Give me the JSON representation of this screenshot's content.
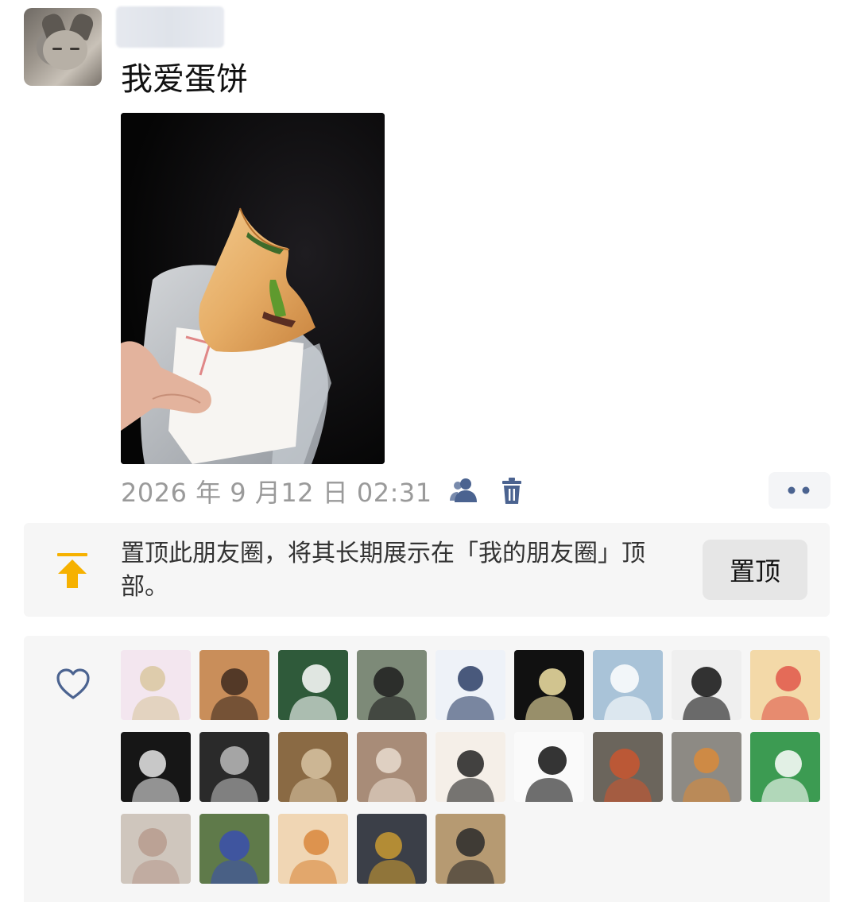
{
  "post": {
    "author_avatar": "cat-avatar",
    "text": "我爱蛋饼",
    "photo": "egg-pancake-photo",
    "timestamp": "2026 年 9 月12 日 02:31"
  },
  "actions": {
    "visibility_icon": "people-icon",
    "delete_icon": "trash-icon",
    "more_icon": "more-dots-icon"
  },
  "pin": {
    "message": "置顶此朋友圈，将其长期展示在「我的朋友圈」顶部。",
    "button_label": "置顶",
    "icon": "pin-to-top-icon",
    "accent_color": "#F6B100"
  },
  "likes": {
    "icon": "heart-outline-icon",
    "avatars": [
      {
        "name": "anime-girl-avatar",
        "bg": "#f3e6ef",
        "fg": "#d9c7a0"
      },
      {
        "name": "girl-with-crown-avatar",
        "bg": "#c98e5a",
        "fg": "#3e2a1e"
      },
      {
        "name": "green-eyes-avatar",
        "bg": "#2f5a3a",
        "fg": "#ffffff"
      },
      {
        "name": "man-outdoors-avatar",
        "bg": "#7d8a78",
        "fg": "#1d1d1d"
      },
      {
        "name": "police-cartoon-avatar",
        "bg": "#eef2f8",
        "fg": "#2b3e66"
      },
      {
        "name": "police-mascot-avatar",
        "bg": "#111111",
        "fg": "#f3e4a6"
      },
      {
        "name": "dog-blue-hat-avatar",
        "bg": "#a9c3d8",
        "fg": "#ffffff"
      },
      {
        "name": "silhouette-avatar",
        "bg": "#efefef",
        "fg": "#111111"
      },
      {
        "name": "redhead-cartoon-avatar",
        "bg": "#f3d9a8",
        "fg": "#e0574a"
      },
      {
        "name": "dark-hair-portrait-avatar",
        "bg": "#161616",
        "fg": "#e8e8e8"
      },
      {
        "name": "bw-couple-avatar",
        "bg": "#2a2a2a",
        "fg": "#bbbbbb"
      },
      {
        "name": "kid-reading-avatar",
        "bg": "#8a6a44",
        "fg": "#d7c3a2"
      },
      {
        "name": "woman-with-toy-avatar",
        "bg": "#a88c78",
        "fg": "#e9dccf"
      },
      {
        "name": "manga-man-avatar",
        "bg": "#f5efe8",
        "fg": "#222222"
      },
      {
        "name": "spiky-hair-sketch-avatar",
        "bg": "#fafafa",
        "fg": "#111111"
      },
      {
        "name": "autumn-street-avatar",
        "bg": "#6b655c",
        "fg": "#c9562f"
      },
      {
        "name": "tiger-cub-avatar",
        "bg": "#8d8a84",
        "fg": "#d98a3a"
      },
      {
        "name": "dog-cartoon-avatar",
        "bg": "#3c9b52",
        "fg": "#ffffff"
      },
      {
        "name": "pig-avatar",
        "bg": "#cfc6bd",
        "fg": "#b79b8e"
      },
      {
        "name": "blueberries-avatar",
        "bg": "#5f7a4a",
        "fg": "#3a4fae"
      },
      {
        "name": "orange-cat-avatar",
        "bg": "#f0d6b4",
        "fg": "#d9873c"
      },
      {
        "name": "robot-figure-avatar",
        "bg": "#3b3f48",
        "fg": "#c99a32"
      },
      {
        "name": "boy-sunglasses-avatar",
        "bg": "#b69a72",
        "fg": "#2a2a2a"
      }
    ]
  }
}
